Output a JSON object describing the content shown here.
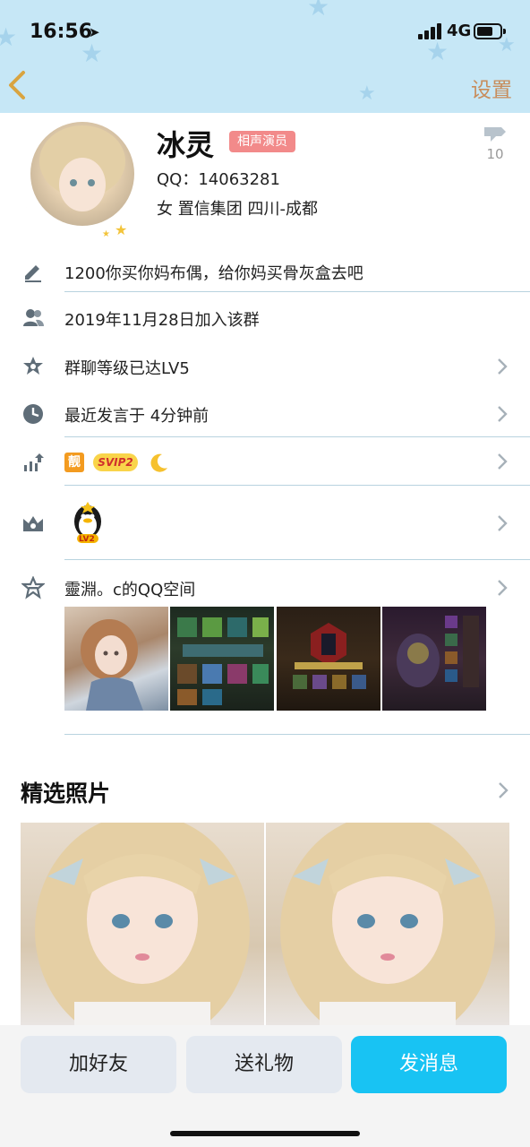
{
  "status_bar": {
    "time": "16:56",
    "network": "4G"
  },
  "nav": {
    "settings_label": "设置"
  },
  "profile": {
    "name": "冰灵",
    "title_tag": "相声演员",
    "qq_line": "QQ：14063281",
    "info_line": "女  置信集团  四川-成都",
    "like_count": "10"
  },
  "rows": {
    "signature": "1200你买你妈布偶，给你妈买骨灰盒去吧",
    "joined": "2019年11月28日加入该群",
    "group_level": "群聊等级已达LV5",
    "last_speak": "最近发言于 4分钟前",
    "badge_liang": "靓",
    "badge_svip": "SVIP2",
    "penguin_level": "LV2",
    "qzone": "靈淵。c的QQ空间"
  },
  "featured": {
    "title": "精选照片"
  },
  "actions": {
    "add_friend": "加好友",
    "send_gift": "送礼物",
    "send_message": "发消息"
  },
  "colors": {
    "header_bg": "#c6e7f6",
    "accent_blue": "#18c3f3",
    "settings_orange": "#c88d5c",
    "tag_red": "#f28a8a",
    "divider": "#b8d3df"
  }
}
